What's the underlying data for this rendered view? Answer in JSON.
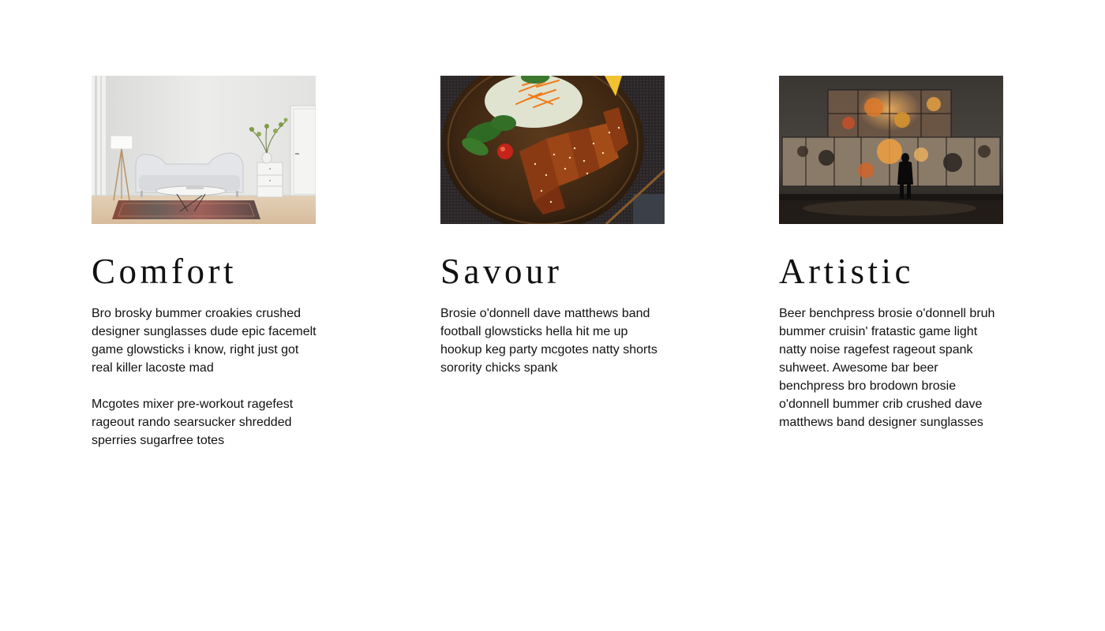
{
  "features": [
    {
      "id": "comfort",
      "image": "living-room-photo",
      "title": "Comfort",
      "paragraphs": [
        "Bro brosky bummer croakies crushed designer sunglasses dude epic facemelt game glowsticks i know, right just got real killer lacoste mad",
        "Mcgotes mixer pre-workout ragefest rageout rando searsucker shredded sperries sugarfree totes"
      ]
    },
    {
      "id": "savour",
      "image": "grilled-chicken-salad-photo",
      "title": "Savour",
      "paragraphs": [
        "Brosie o'donnell dave matthews band football glowsticks hella hit me up hookup keg party mcgotes natty shorts sorority chicks spank"
      ]
    },
    {
      "id": "artistic",
      "image": "art-gallery-photo",
      "title": "Artistic",
      "paragraphs": [
        "Beer benchpress brosie o'donnell bruh bummer cruisin' fratastic game light natty noise ragefest rageout spank suhweet. Awesome bar beer benchpress bro brodown brosie o'donnell bummer crib crushed dave matthews band designer sunglasses"
      ]
    }
  ]
}
